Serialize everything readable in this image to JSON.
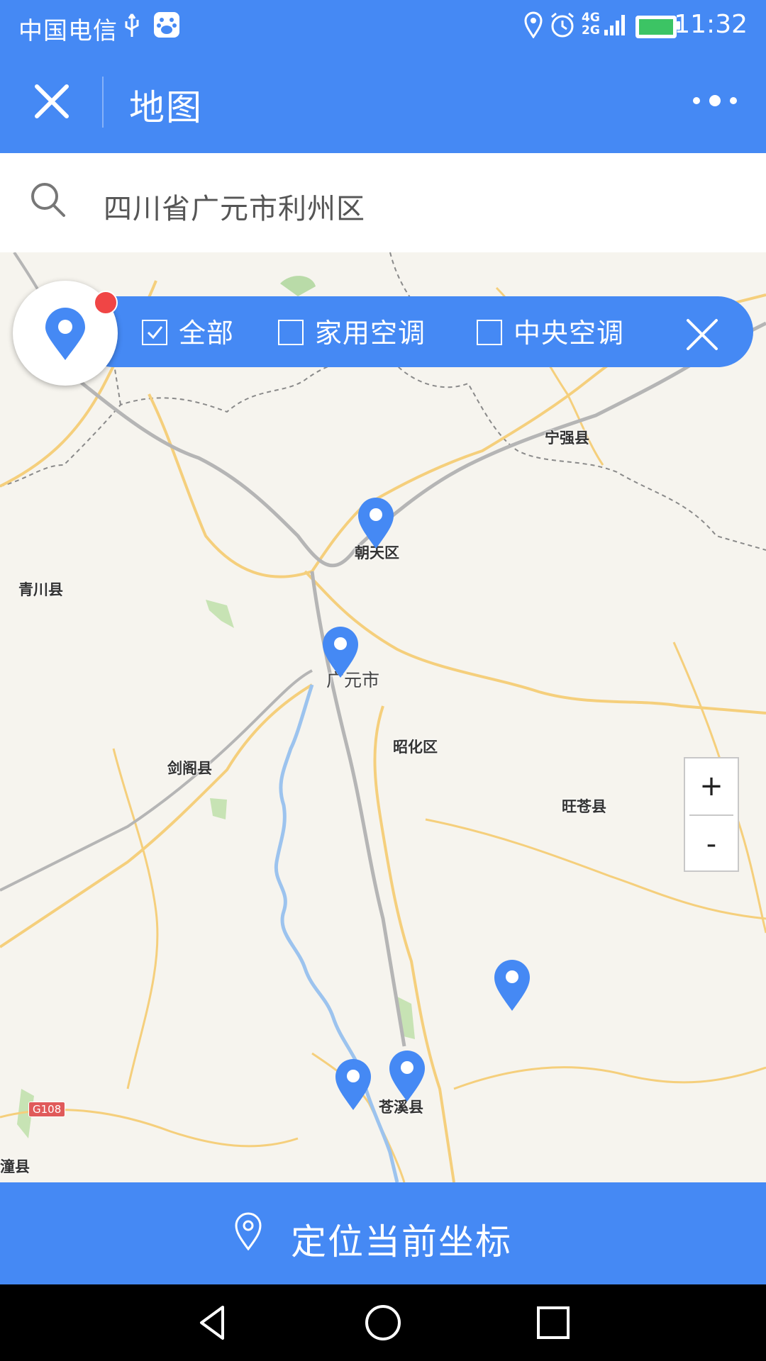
{
  "status_bar": {
    "carrier": "中国电信",
    "network": "4G",
    "network2": "2G",
    "time": "11:32"
  },
  "title_bar": {
    "title": "地图"
  },
  "search": {
    "value": "四川省广元市利州区"
  },
  "filter": {
    "options": [
      {
        "label": "全部",
        "checked": true
      },
      {
        "label": "家用空调",
        "checked": false
      },
      {
        "label": "中央空调",
        "checked": false
      }
    ]
  },
  "map": {
    "places": {
      "ningqiang": "宁强县",
      "chaotian": "朝天区",
      "qingchuan": "青川县",
      "guangyuan": "广元市",
      "zhaohua": "昭化区",
      "jiange": "剑阁县",
      "wangcang": "旺苍县",
      "cangxi": "苍溪县",
      "zitong": "潼县"
    },
    "road_badge": "G108",
    "zoom_in": "+",
    "zoom_out": "-"
  },
  "bottom": {
    "label": "定位当前坐标"
  },
  "colors": {
    "accent": "#4589f4",
    "marker": "#4589f4",
    "dot": "#f04545"
  }
}
